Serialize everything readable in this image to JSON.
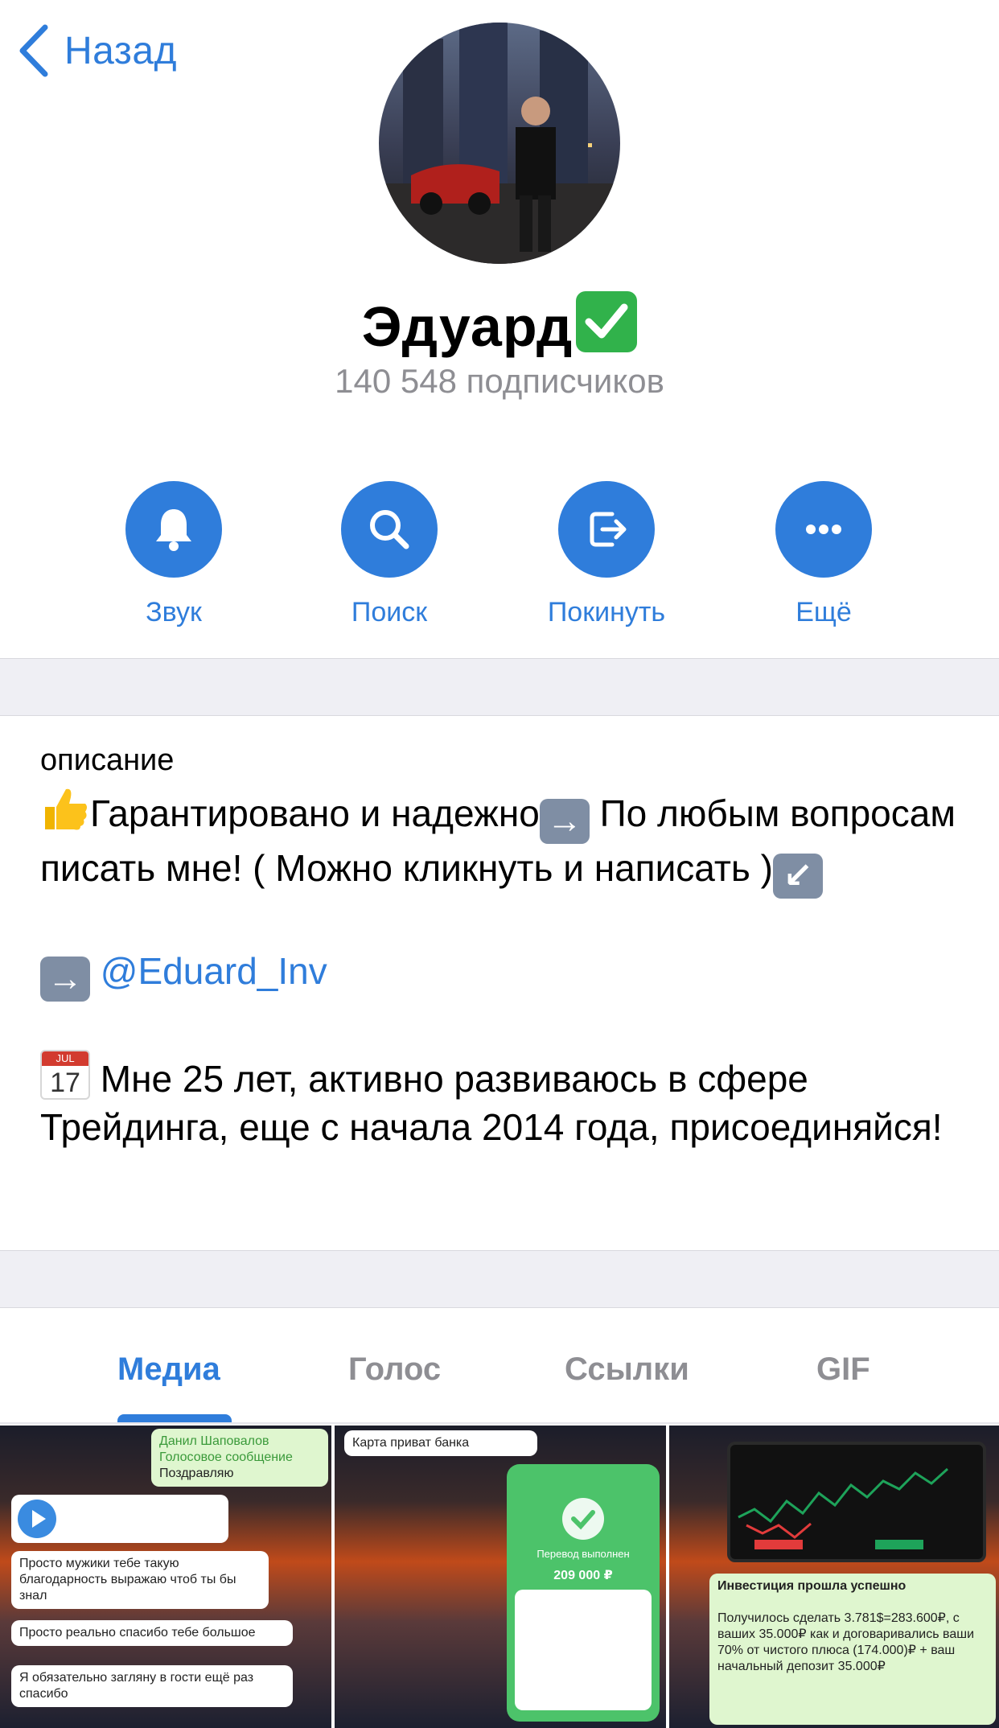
{
  "nav": {
    "back_label": "Назад"
  },
  "channel": {
    "name": "Эдуард",
    "subscribers": "140 548 подписчиков"
  },
  "actions": [
    {
      "label": "Звук",
      "icon": "bell-icon"
    },
    {
      "label": "Поиск",
      "icon": "search-icon"
    },
    {
      "label": "Покинуть",
      "icon": "leave-icon"
    },
    {
      "label": "Ещё",
      "icon": "more-icon"
    }
  ],
  "description": {
    "title": "описание",
    "line1": "Гарантировано и надежно",
    "line1b": " По любым вопросам писать мне! ( Можно кликнуть и написать )",
    "mention": "@Eduard_Inv",
    "cal_month": "JUL",
    "cal_day": "17",
    "line3": " Мне 25 лет, активно развиваюсь в сфере Трейдинга, еще с начала 2014 года, присоединяйся!"
  },
  "tabs": [
    {
      "label": "Медиа",
      "active": true
    },
    {
      "label": "Голос",
      "active": false
    },
    {
      "label": "Ссылки",
      "active": false
    },
    {
      "label": "GIF",
      "active": false
    }
  ],
  "media": [
    {
      "msgs": [
        "Данил Шаповалов",
        "Голосовое сообщение",
        "Поздравляю",
        "Просто мужики тебе такую благодарность выражаю чтоб ты бы знал",
        "Просто реально спасибо тебе большое",
        "Я обязательно загляну в гости ещё раз спасибо"
      ]
    },
    {
      "msgs": [
        "Карта приват банка",
        "Перевод выполнен",
        "209 000 ₽"
      ]
    },
    {
      "msgs": [
        "Инвестиция прошла успешно",
        "Получилось сделать 3.781$=283.600₽, с ваших 35.000₽ как и договаривались ваши 70% от чистого плюса (174.000)₽ + ваш начальный депозит 35.000₽"
      ]
    }
  ],
  "colors": {
    "accent": "#2f7ddb",
    "muted": "#8e8e93",
    "separator": "#efeff4"
  }
}
